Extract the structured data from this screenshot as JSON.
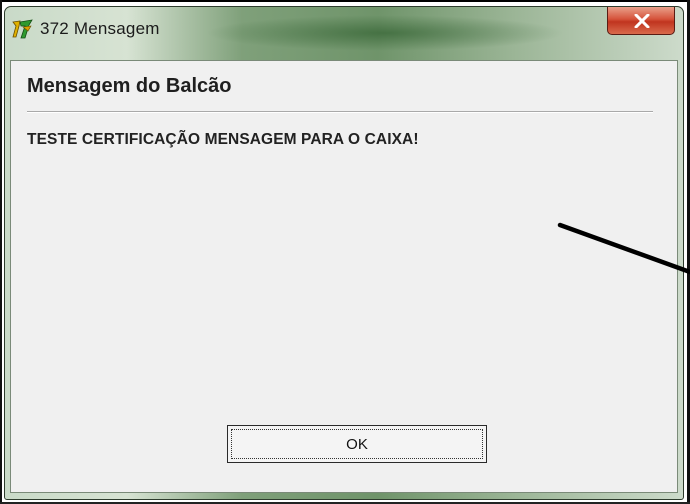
{
  "window": {
    "title": "372 Mensagem",
    "close_icon": "close-x-icon",
    "app_icon": "app-logo-icon"
  },
  "dialog": {
    "heading": "Mensagem do Balcão",
    "message": "TESTE CERTIFICAÇÃO MENSAGEM PARA O CAIXA!",
    "ok_label": "OK"
  },
  "colors": {
    "client_background": "#f0f0f0",
    "close_button": "#c0341f",
    "title_glass": "#6f946a"
  }
}
